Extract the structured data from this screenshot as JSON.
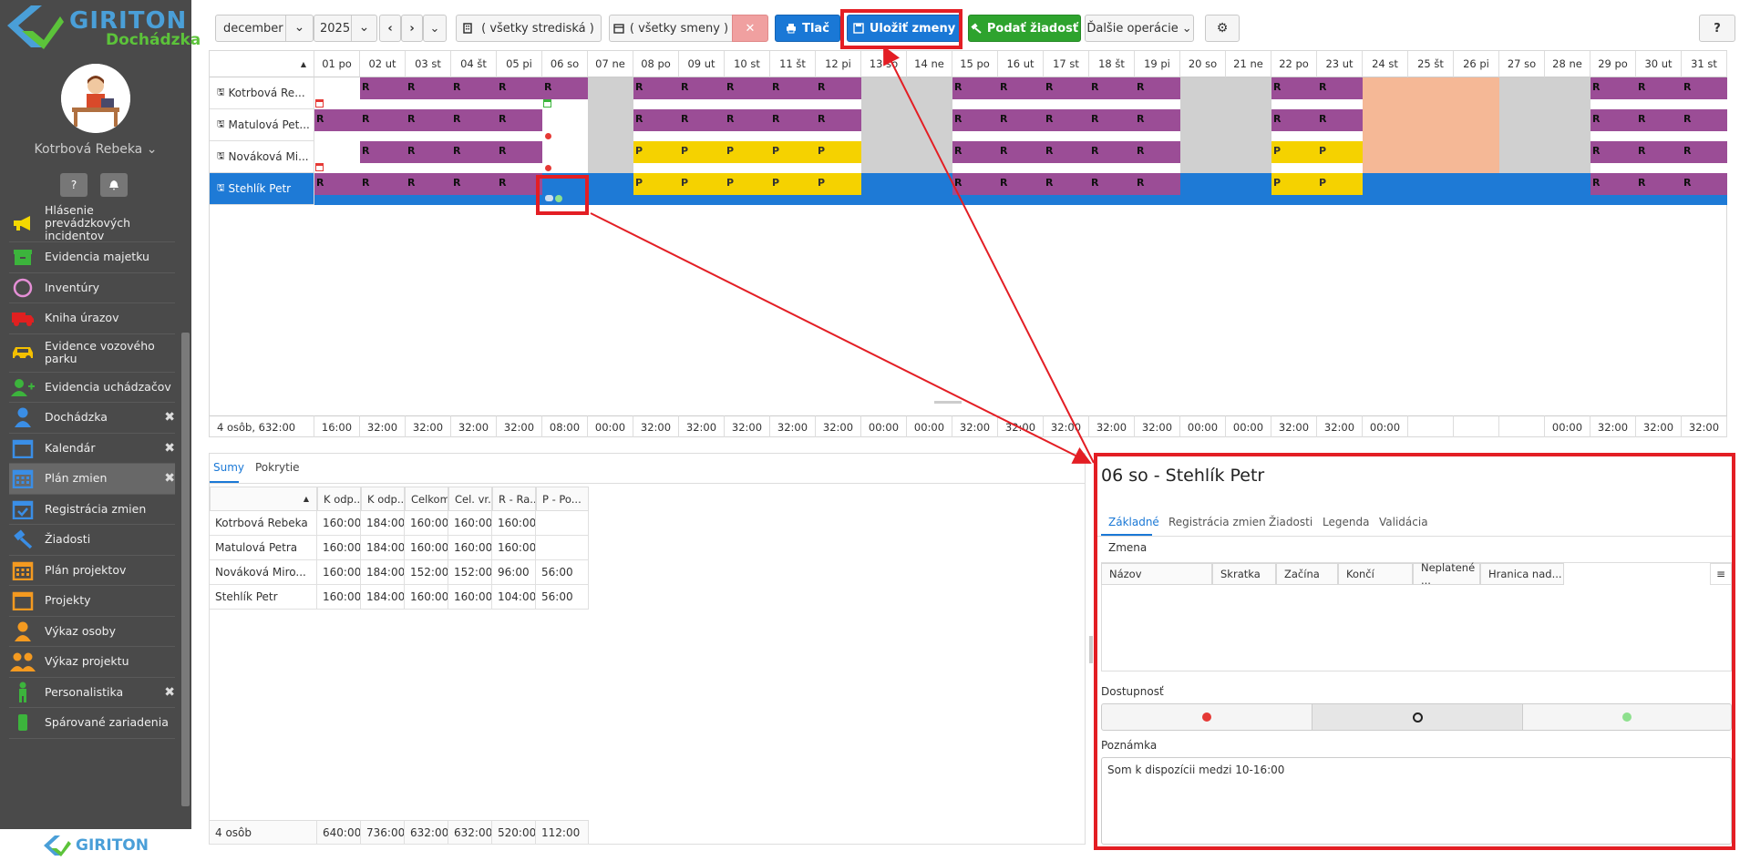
{
  "brand": {
    "name": "GIRITON",
    "product": "Dochádzka",
    "footer": "GIRITON"
  },
  "user": {
    "name": "Kotrbová Rebeka"
  },
  "sidebar": {
    "items": [
      {
        "label": "Hlásenie prevádzkových incidentov",
        "icon": "megaphone-icon",
        "color": "#f4d800",
        "closable": false
      },
      {
        "label": "Evidencia majetku",
        "icon": "box-icon",
        "color": "#3cb43c",
        "closable": false
      },
      {
        "label": "Inventúry",
        "icon": "circle-icon",
        "color": "#e58fd6",
        "closable": false
      },
      {
        "label": "Kniha úrazov",
        "icon": "ambulance-icon",
        "color": "#e02020",
        "closable": false
      },
      {
        "label": "Evidence vozového parku",
        "icon": "car-icon",
        "color": "#f4c000",
        "closable": false
      },
      {
        "label": "Evidencia uchádzačov",
        "icon": "user-plus-icon",
        "color": "#3cb43c",
        "closable": false
      },
      {
        "label": "Dochádzka",
        "icon": "user-icon",
        "color": "#3a8ee6",
        "closable": true
      },
      {
        "label": "Kalendár",
        "icon": "calendar-icon",
        "color": "#3a8ee6",
        "closable": true
      },
      {
        "label": "Plán zmien",
        "icon": "calendar-grid-icon",
        "color": "#3a8ee6",
        "closable": true,
        "active": true
      },
      {
        "label": "Registrácia zmien",
        "icon": "calendar-check-icon",
        "color": "#3a8ee6",
        "closable": false
      },
      {
        "label": "Žiadosti",
        "icon": "gavel-icon",
        "color": "#3a8ee6",
        "closable": false
      },
      {
        "label": "Plán projektov",
        "icon": "calendar-grid-icon",
        "color": "#f49a20",
        "closable": false
      },
      {
        "label": "Projekty",
        "icon": "calendar-icon",
        "color": "#f49a20",
        "closable": false
      },
      {
        "label": "Výkaz osoby",
        "icon": "user-icon",
        "color": "#f49a20",
        "closable": false
      },
      {
        "label": "Výkaz projektu",
        "icon": "users-icon",
        "color": "#f49a20",
        "closable": false
      },
      {
        "label": "Personalistika",
        "icon": "person-icon",
        "color": "#3cb43c",
        "closable": true
      },
      {
        "label": "Spárované zariadenia",
        "icon": "device-icon",
        "color": "#3cb43c",
        "closable": false
      }
    ]
  },
  "toolbar": {
    "month": "december",
    "year": "2025",
    "center": "( všetky strediská )",
    "shifts": "( všetky smeny )",
    "print": "Tlač",
    "save": "Uložiť zmeny",
    "request": "Podať žiadosť",
    "more": "Ďalšie operácie",
    "help": "?"
  },
  "grid": {
    "days": [
      "01 po",
      "02 ut",
      "03 st",
      "04 št",
      "05 pi",
      "06 so",
      "07 ne",
      "08 po",
      "09 ut",
      "10 st",
      "11 št",
      "12 pi",
      "13 so",
      "14 ne",
      "15 po",
      "16 ut",
      "17 st",
      "18 št",
      "19 pi",
      "20 so",
      "21 ne",
      "22 po",
      "23 ut",
      "24 st",
      "25 št",
      "26 pi",
      "27 so",
      "28 ne",
      "29 po",
      "30 ut",
      "31 st"
    ],
    "employees": [
      {
        "name": "Kotrbová Re...",
        "selected": false,
        "cells": [
          "E",
          "R",
          "R",
          "R",
          "R",
          "R",
          "W",
          "R",
          "R",
          "R",
          "R",
          "R",
          "W",
          "W",
          "R",
          "R",
          "R",
          "R",
          "R",
          "W",
          "W",
          "R",
          "R",
          "H",
          "H",
          "H",
          "W",
          "W",
          "R",
          "R",
          "R"
        ]
      },
      {
        "name": "Matulová Pet...",
        "selected": false,
        "cells": [
          "R",
          "R",
          "R",
          "R",
          "R",
          "E",
          "W",
          "R",
          "R",
          "R",
          "R",
          "R",
          "W",
          "W",
          "R",
          "R",
          "R",
          "R",
          "R",
          "W",
          "W",
          "R",
          "R",
          "H",
          "H",
          "H",
          "W",
          "W",
          "R",
          "R",
          "R"
        ]
      },
      {
        "name": "Nováková Mi...",
        "selected": false,
        "cells": [
          "E",
          "R",
          "R",
          "R",
          "R",
          "E",
          "W",
          "P",
          "P",
          "P",
          "P",
          "P",
          "W",
          "W",
          "R",
          "R",
          "R",
          "R",
          "R",
          "W",
          "W",
          "P",
          "P",
          "H",
          "H",
          "H",
          "W",
          "W",
          "R",
          "R",
          "R"
        ]
      },
      {
        "name": "Stehlík Petr",
        "selected": true,
        "cells": [
          "R",
          "R",
          "R",
          "R",
          "R",
          "E",
          "E",
          "P",
          "P",
          "P",
          "P",
          "P",
          "E",
          "E",
          "R",
          "R",
          "R",
          "R",
          "R",
          "E",
          "E",
          "P",
          "P",
          "E",
          "E",
          "E",
          "E",
          "E",
          "R",
          "R",
          "R"
        ]
      }
    ],
    "total_label": "4 osôb, 632:00",
    "totals": [
      "16:00",
      "32:00",
      "32:00",
      "32:00",
      "32:00",
      "08:00",
      "00:00",
      "32:00",
      "32:00",
      "32:00",
      "32:00",
      "32:00",
      "00:00",
      "00:00",
      "32:00",
      "32:00",
      "32:00",
      "32:00",
      "32:00",
      "00:00",
      "00:00",
      "32:00",
      "32:00",
      "00:00",
      "",
      "",
      "",
      "00:00",
      "32:00",
      "32:00",
      "32:00"
    ]
  },
  "colors": {
    "R": "#9b4d96",
    "P": "#f5d200",
    "W": "#d0d0d0",
    "H": "#f5b896",
    "selected": "#1e7ad6",
    "save_highlight": "#e31e24"
  },
  "sums": {
    "tabs": [
      "Sumy",
      "Pokrytie"
    ],
    "headers": [
      "K odp...",
      "K odp...",
      "Celkom",
      "Cel. vr...",
      "R - Ra...",
      "P - Po..."
    ],
    "rows": [
      {
        "name": "Kotrbová Rebeka",
        "vals": [
          "160:00",
          "184:00",
          "160:00",
          "160:00",
          "160:00",
          ""
        ]
      },
      {
        "name": "Matulová Petra",
        "vals": [
          "160:00",
          "184:00",
          "160:00",
          "160:00",
          "160:00",
          ""
        ]
      },
      {
        "name": "Nováková Miro...",
        "vals": [
          "160:00",
          "184:00",
          "152:00",
          "152:00",
          "96:00",
          "56:00"
        ]
      },
      {
        "name": "Stehlík Petr",
        "vals": [
          "160:00",
          "184:00",
          "160:00",
          "160:00",
          "104:00",
          "56:00"
        ]
      }
    ],
    "footer": {
      "name": "4 osôb",
      "vals": [
        "640:00",
        "736:00",
        "632:00",
        "632:00",
        "520:00",
        "112:00"
      ]
    }
  },
  "detail": {
    "title": "06 so - Stehlík Petr",
    "tabs": [
      "Základné",
      "Registrácia zmien",
      "Žiadosti",
      "Legenda",
      "Validácia"
    ],
    "shift_label": "Zmena",
    "columns": [
      "Názov",
      "Skratka",
      "Začína",
      "Končí",
      "Neplatené ...",
      "Hranica nad..."
    ],
    "availability_label": "Dostupnosť",
    "note_label": "Poznámka",
    "note": "Som k dispozícii medzi 10-16:00"
  }
}
